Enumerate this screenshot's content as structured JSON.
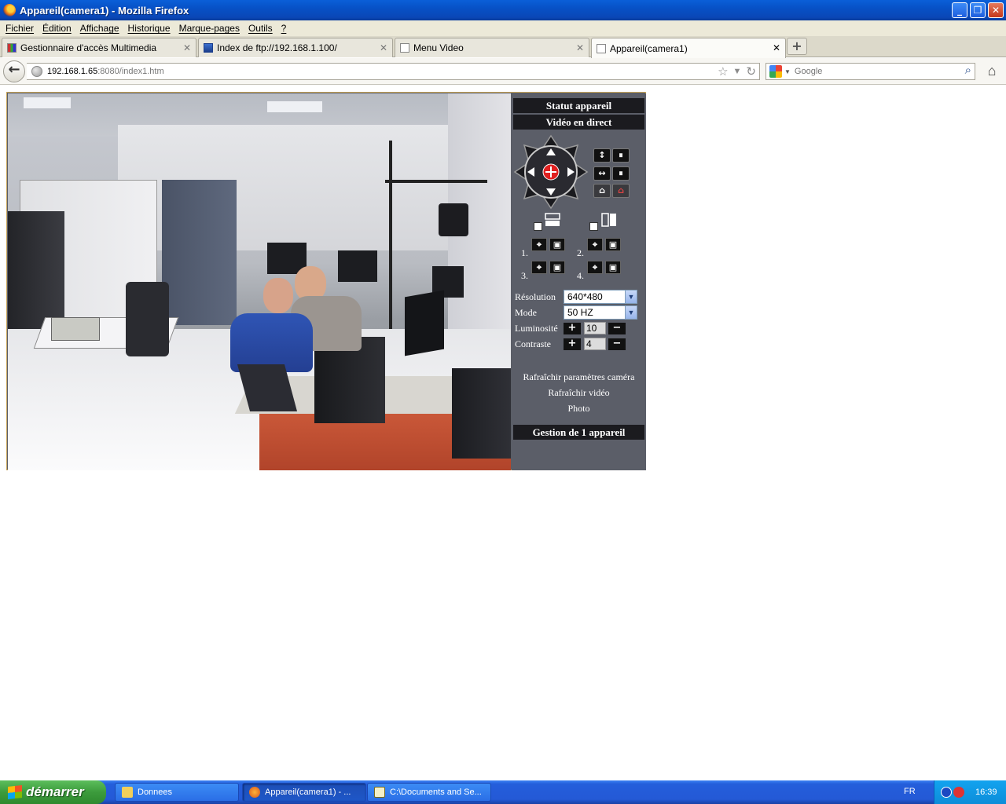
{
  "window": {
    "title": "Appareil(camera1) - Mozilla Firefox",
    "controls": {
      "minimize": "_",
      "maximize": "❐",
      "close": "✕"
    }
  },
  "menu": [
    "Fichier",
    "Édition",
    "Affichage",
    "Historique",
    "Marque-pages",
    "Outils",
    "?"
  ],
  "tabs": [
    {
      "label": "Gestionnaire d'accès Multimedia",
      "icon": "app-icon",
      "active": false
    },
    {
      "label": "Index de ftp://192.168.1.100/",
      "icon": "ftp-icon",
      "active": false
    },
    {
      "label": "Menu Video",
      "icon": "page-icon",
      "active": false
    },
    {
      "label": "Appareil(camera1)",
      "icon": "page-icon",
      "active": true
    }
  ],
  "tab_close": "✕",
  "new_tab": "+",
  "nav": {
    "url_host": "192.168.1.65",
    "url_rest": ":8080/index1.htm",
    "search_placeholder": "Google"
  },
  "camera": {
    "panel": {
      "status_heading": "Statut appareil",
      "live_heading": "Vidéo en direct",
      "presets": [
        "1.",
        "2.",
        "3.",
        "4."
      ],
      "resolution_label": "Résolution",
      "resolution_value": "640*480",
      "mode_label": "Mode",
      "mode_value": "50 HZ",
      "brightness_label": "Luminosité",
      "brightness_value": "10",
      "contrast_label": "Contraste",
      "contrast_value": "4",
      "plus": "+",
      "minus": "−",
      "refresh_params": "Rafraîchir paramètres caméra",
      "refresh_video": "Rafraîchir vidéo",
      "photo": "Photo",
      "management_heading": "Gestion de 1 appareil"
    }
  },
  "taskbar": {
    "start": "démarrer",
    "items": [
      {
        "label": "Donnees",
        "active": false
      },
      {
        "label": "Appareil(camera1) - ...",
        "active": true
      },
      {
        "label": "C:\\Documents and Se...",
        "active": false
      }
    ],
    "lang": "FR",
    "clock": "16:39"
  },
  "colors": {
    "title_blue": "#0a5fd8",
    "panel_bg": "#5b5e68",
    "panel_head": "#1b1b1f",
    "frame_border": "#c8a55a"
  }
}
